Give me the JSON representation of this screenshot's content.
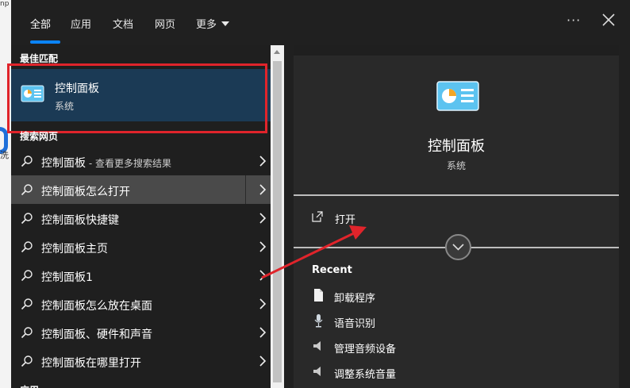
{
  "background": {
    "top_fragment": "np",
    "side_fragment": "洗"
  },
  "tabs": [
    {
      "label": "全部"
    },
    {
      "label": "应用"
    },
    {
      "label": "文档"
    },
    {
      "label": "网页"
    },
    {
      "label": "更多"
    }
  ],
  "best_match": {
    "section_title": "最佳匹配",
    "name": "控制面板",
    "type": "系统"
  },
  "web_search": {
    "section_title": "搜索网页",
    "items": [
      {
        "label": "控制面板",
        "extra": " - 查看更多搜索结果"
      },
      {
        "label": "控制面板怎么打开",
        "extra": ""
      },
      {
        "label": "控制面板快捷键",
        "extra": ""
      },
      {
        "label": "控制面板主页",
        "extra": ""
      },
      {
        "label": "控制面板1",
        "extra": ""
      },
      {
        "label": "控制面板怎么放在桌面",
        "extra": ""
      },
      {
        "label": "控制面板、硬件和声音",
        "extra": ""
      },
      {
        "label": "控制面板在哪里打开",
        "extra": ""
      }
    ],
    "next_section": "应用"
  },
  "detail": {
    "name": "控制面板",
    "type": "系统",
    "open_label": "打开",
    "recent_title": "Recent",
    "recent": [
      {
        "label": "卸载程序",
        "icon": "document-icon"
      },
      {
        "label": "语音识别",
        "icon": "microphone-icon"
      },
      {
        "label": "管理音频设备",
        "icon": "speaker-icon"
      },
      {
        "label": "调整系统音量",
        "icon": "speaker-icon"
      }
    ]
  },
  "colors": {
    "accent": "#0a84ff",
    "highlight_box": "#e0242b",
    "selected_bg": "#1b3a55"
  }
}
